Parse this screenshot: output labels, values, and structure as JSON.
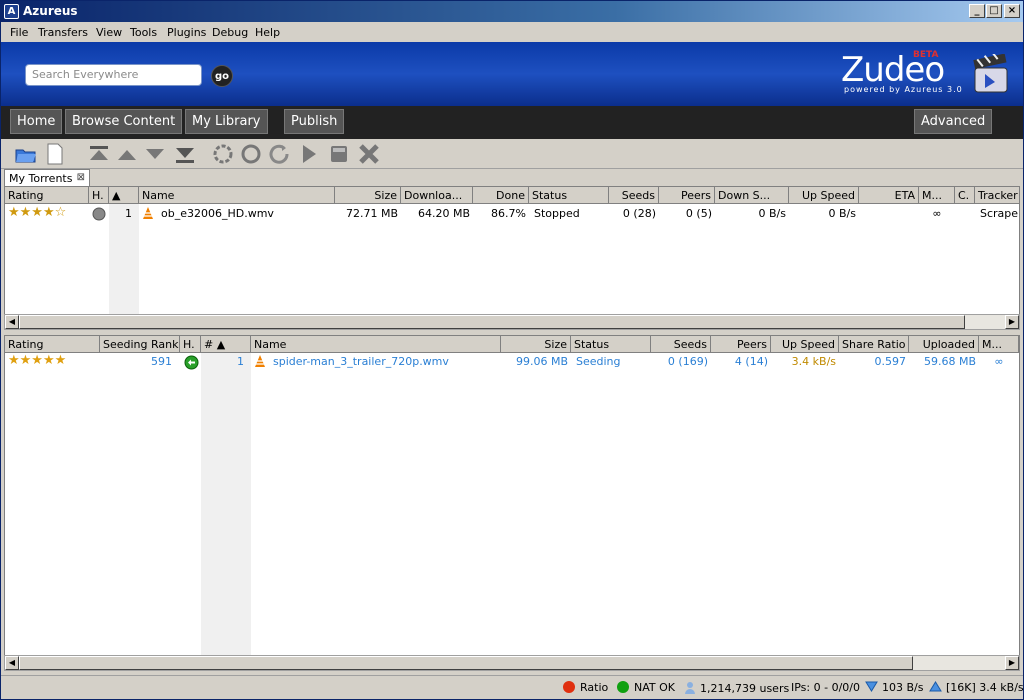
{
  "window": {
    "title": "Azureus"
  },
  "menu": [
    "File",
    "Transfers",
    "View",
    "Tools",
    "Plugins",
    "Debug",
    "Help"
  ],
  "banner": {
    "search_placeholder": "Search Everywhere",
    "go_label": "go",
    "logo": "Zudeo",
    "logo_beta": "BETA",
    "logo_sub": "powered by Azureus 3.0"
  },
  "nav": {
    "home": "Home",
    "browse": "Browse Content",
    "library": "My Library",
    "publish": "Publish",
    "advanced": "Advanced"
  },
  "tab": {
    "label": "My Torrents"
  },
  "downloading": {
    "columns": [
      "Rating",
      "H.",
      "",
      "Name",
      "Size",
      "Downloa...",
      "Done",
      "Status",
      "Seeds",
      "Peers",
      "Down S...",
      "Up Speed",
      "ETA",
      "M...",
      "C.",
      "Tracker S"
    ],
    "rows": [
      {
        "rating": "★★★★☆",
        "num": "1",
        "name": "ob_e32006_HD.wmv",
        "size": "72.71 MB",
        "downloaded": "64.20 MB",
        "done": "86.7%",
        "status": "Stopped",
        "seeds": "0 (28)",
        "peers": "0 (5)",
        "down_speed": "0 B/s",
        "up_speed": "0 B/s",
        "max": "∞",
        "tracker": "Scrape C"
      }
    ]
  },
  "seeding": {
    "columns": [
      "Rating",
      "Seeding Rank",
      "H.",
      "#",
      "Name",
      "Size",
      "Status",
      "Seeds",
      "Peers",
      "Up Speed",
      "Share Ratio",
      "Uploaded",
      "M..."
    ],
    "rows": [
      {
        "rating": "★★★★★",
        "rank": "591",
        "num": "1",
        "name": "spider-man_3_trailer_720p.wmv",
        "size": "99.06 MB",
        "status": "Seeding",
        "seeds": "0 (169)",
        "peers": "4 (14)",
        "up_speed": "3.4 kB/s",
        "share_ratio": "0.597",
        "uploaded": "59.68 MB",
        "max": "∞"
      }
    ]
  },
  "status": {
    "ratio": "Ratio",
    "nat": "NAT OK",
    "users": "1,214,739 users",
    "ips": "IPs: 0 - 0/0/0",
    "down": "103 B/s",
    "up": "[16K] 3.4 kB/s"
  },
  "colors": {
    "banner": "#1e50c0",
    "nav": "#222222",
    "link_blue": "#2a7fd4",
    "speed_gold": "#c08a00",
    "ratio_red": "#e03010",
    "nat_green": "#10a010"
  }
}
